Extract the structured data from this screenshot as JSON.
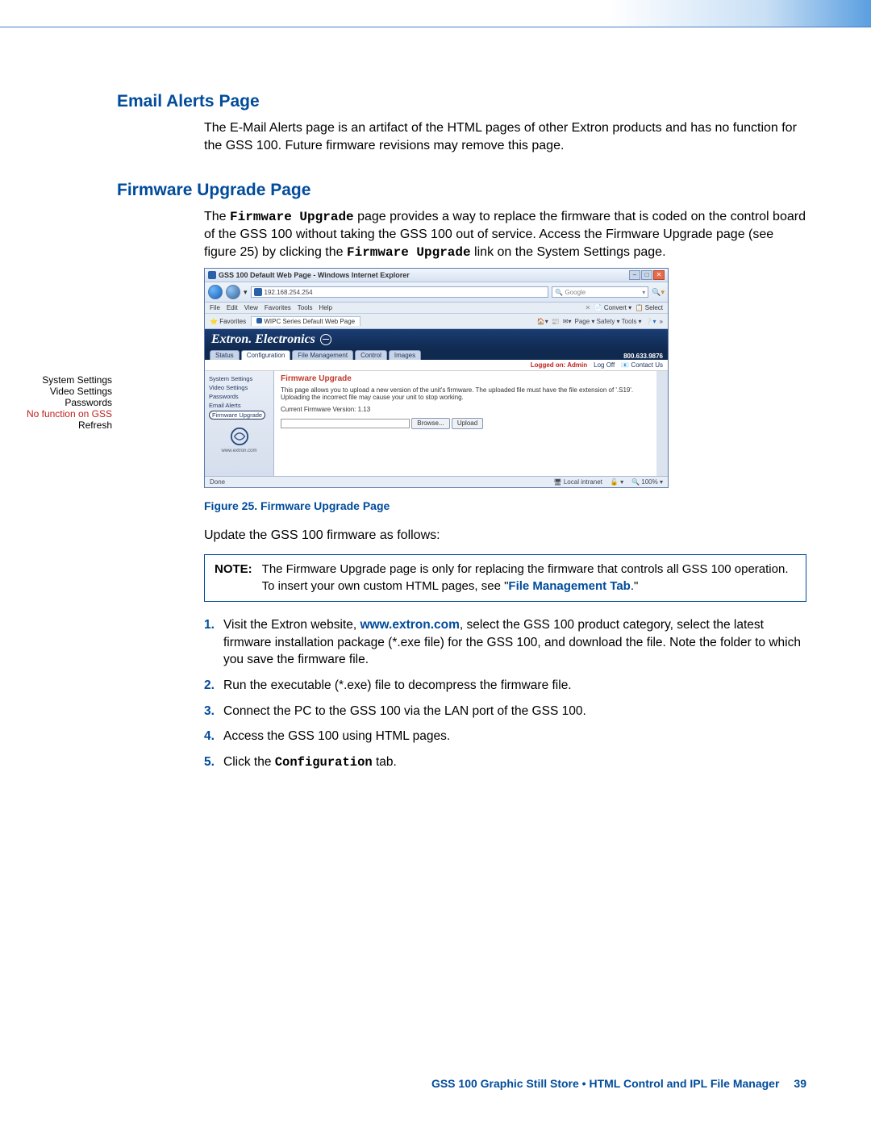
{
  "sections": {
    "email_alerts": {
      "heading": "Email Alerts Page",
      "body": "The E-Mail Alerts page is an artifact of the HTML pages of other Extron products and has no function for the GSS 100. Future firmware revisions may remove this page."
    },
    "firmware_upgrade": {
      "heading": "Firmware Upgrade Page",
      "intro_pre": "The ",
      "intro_mono1": "Firmware Upgrade",
      "intro_mid": " page provides a way to replace the firmware that is coded on the control board of the GSS 100 without taking the GSS 100 out of service. Access the Firmware Upgrade page (see figure 25) by clicking the ",
      "intro_mono2": "Firmware Upgrade",
      "intro_post": " link on the System Settings page."
    }
  },
  "side_labels": {
    "l1": "System Settings",
    "l2": "Video Settings",
    "l3": "Passwords",
    "l4_red": "No function on GSS",
    "l5": "Refresh"
  },
  "screenshot": {
    "title": "GSS 100 Default Web Page - Windows Internet Explorer",
    "address": "192.168.254.254",
    "menu": [
      "File",
      "Edit",
      "View",
      "Favorites",
      "Tools",
      "Help"
    ],
    "convert": "Convert ▾",
    "select": "Select",
    "fav_label": "Favorites",
    "fav_tab": "WIPC Series Default Web Page",
    "toolbar_right": "Page ▾   Safety ▾   Tools ▾",
    "search_hint": "Google",
    "brand": "Extron. Electronics",
    "tabs": [
      "Status",
      "Configuration",
      "File Management",
      "Control",
      "Images"
    ],
    "phone": "800.633.9876",
    "logged": "Logged on: Admin",
    "logoff": "Log Off",
    "contact": "Contact Us",
    "sidebar": {
      "i1": "System Settings",
      "i2": "Video Settings",
      "i3": "Passwords",
      "i4": "Email Alerts",
      "i5": "Firmware Upgrade",
      "url": "www.extron.com"
    },
    "main": {
      "h": "Firmware Upgrade",
      "p": "This page allows you to upload a new version of the unit's firmware. The uploaded file must have the file extension of '.S19'. Uploading the incorrect file may cause your unit to stop working.",
      "ver": "Current Firmware Version: 1.13",
      "browse": "Browse...",
      "upload": "Upload"
    },
    "status_done": "Done",
    "status_zone": "Local intranet",
    "status_zoom": "100%"
  },
  "fig_caption_pre": "Figure 25. ",
  "fig_caption": "Firmware Upgrade Page",
  "update_line": "Update the GSS 100 firmware as follows:",
  "note": {
    "label": "NOTE:",
    "text_pre": "The Firmware Upgrade page is only for replacing the firmware that controls all GSS 100 operation. To insert your own custom HTML pages, see \"",
    "link": "File Management Tab",
    "text_post": ".\""
  },
  "steps": [
    {
      "n": "1.",
      "pre": "Visit the Extron website, ",
      "link": "www.extron.com",
      "post": ", select the GSS 100 product category, select the latest firmware installation package (*.exe file) for the GSS 100, and download the file. Note the folder to which you save the firmware file."
    },
    {
      "n": "2.",
      "text": "Run the executable (*.exe) file to decompress the firmware file."
    },
    {
      "n": "3.",
      "text": "Connect the PC to the GSS 100 via the LAN port of the GSS 100."
    },
    {
      "n": "4.",
      "text": "Access the GSS 100 using HTML pages."
    },
    {
      "n": "5.",
      "pre": "Click the ",
      "mono": "Configuration",
      "post": " tab."
    }
  ],
  "footer": {
    "text": "GSS 100 Graphic Still Store • HTML Control and IPL File Manager",
    "page": "39"
  }
}
